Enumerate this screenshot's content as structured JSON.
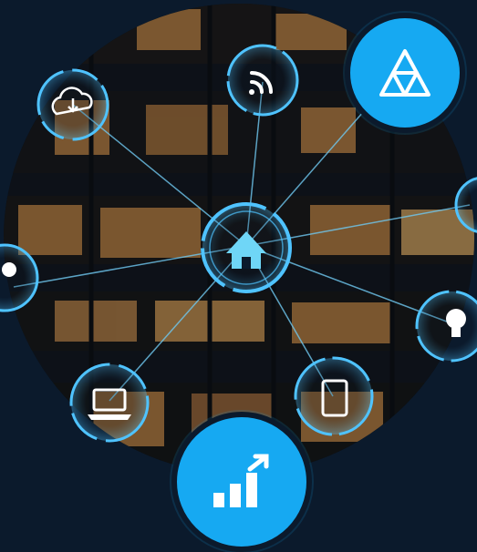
{
  "scene": {
    "description_icons": [
      "cloud-download-icon",
      "wifi-icon",
      "home-icon",
      "laptop-icon",
      "tablet-icon",
      "lightbulb-icon",
      "person-icon"
    ],
    "colors": {
      "background": "#0b1a2c",
      "accent": "#16a9f2",
      "glow": "#4fc3ff",
      "window_light": "#e0a050"
    }
  },
  "badges": {
    "top_icon": "triangle-network-icon",
    "bottom_icon": "growth-chart-icon"
  }
}
